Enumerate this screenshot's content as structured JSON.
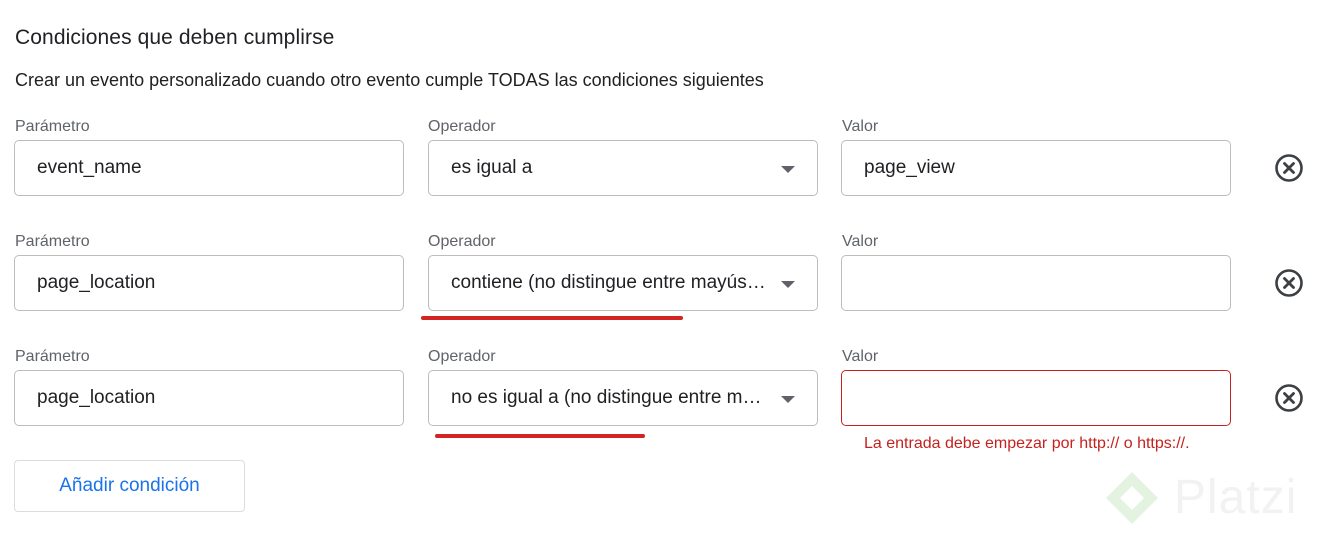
{
  "section": {
    "title": "Condiciones que deben cumplirse",
    "subtitle": "Crear un evento personalizado cuando otro evento cumple TODAS las condiciones siguientes"
  },
  "labels": {
    "param": "Parámetro",
    "operator": "Operador",
    "value": "Valor"
  },
  "conditions": [
    {
      "param": "event_name",
      "operator": "es igual a",
      "value": "page_view"
    },
    {
      "param": "page_location",
      "operator": "contiene (no distingue entre mayúsculas y minúsculas)",
      "value": ""
    },
    {
      "param": "page_location",
      "operator": "no es igual a (no distingue entre mayúsculas y minúsculas)",
      "value": ""
    }
  ],
  "error": {
    "message": "La entrada debe empezar por http:// o https://.",
    "color": "#c5221f"
  },
  "add_button": {
    "label": "Añadir condición"
  },
  "watermark": {
    "text": "Platzi"
  },
  "colors": {
    "accent": "#1a73e8",
    "annotation": "#d32424"
  }
}
